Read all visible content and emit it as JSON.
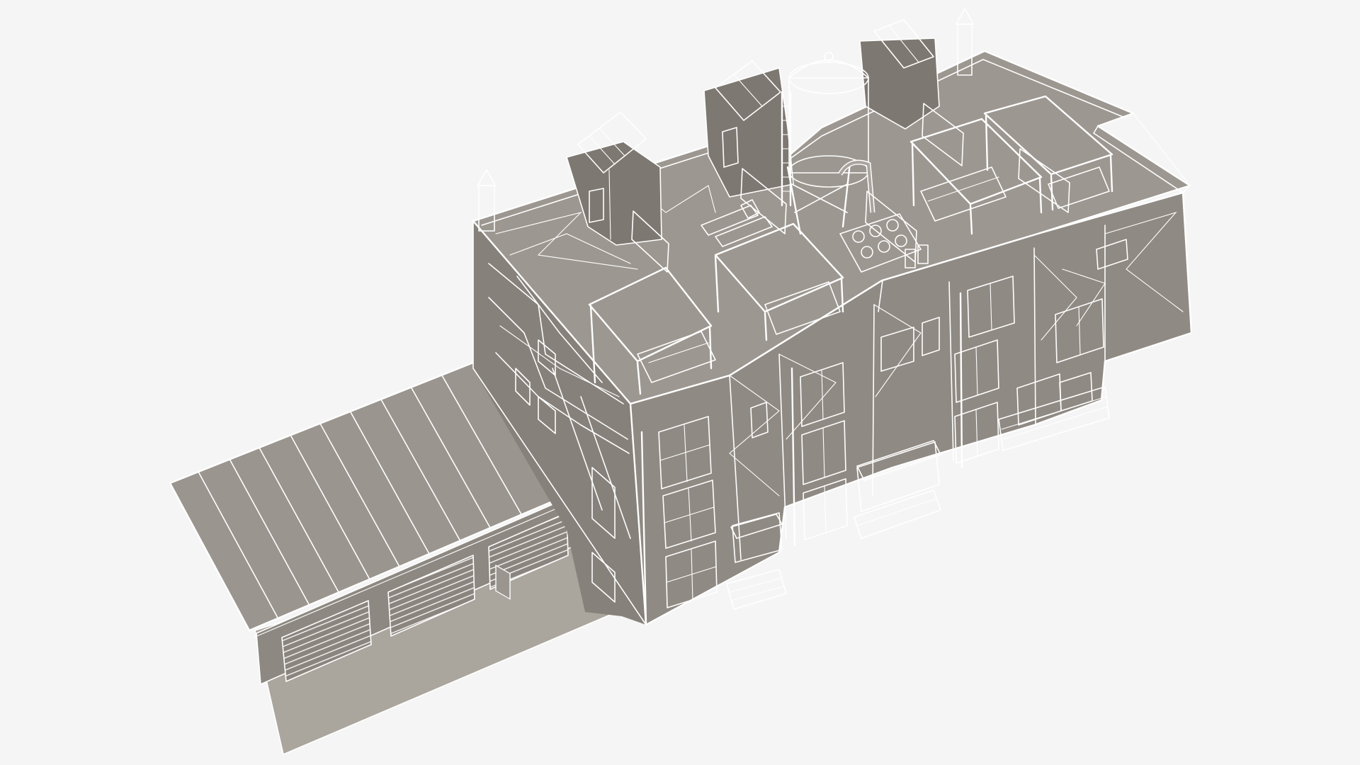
{
  "scene": {
    "description_visible_text": "",
    "subject": "building-3d-wireframe-render"
  },
  "colors": {
    "background": "#f5f5f5",
    "roof": "#9c9790",
    "wall_front": "#8f8a83",
    "wall_side": "#7d7871",
    "wall_dark": "#6e6963",
    "ground": "#a8a39b",
    "shadow": "#8a857e",
    "wire": "#ffffff",
    "window": "#d9d6d1"
  },
  "icons": {
    "water_tower": "water-tower-icon",
    "pergola": "pergola-icon",
    "solar_panel": "solar-panel-icon",
    "chimney": "chimney-icon",
    "garage_door": "garage-door-icon"
  }
}
